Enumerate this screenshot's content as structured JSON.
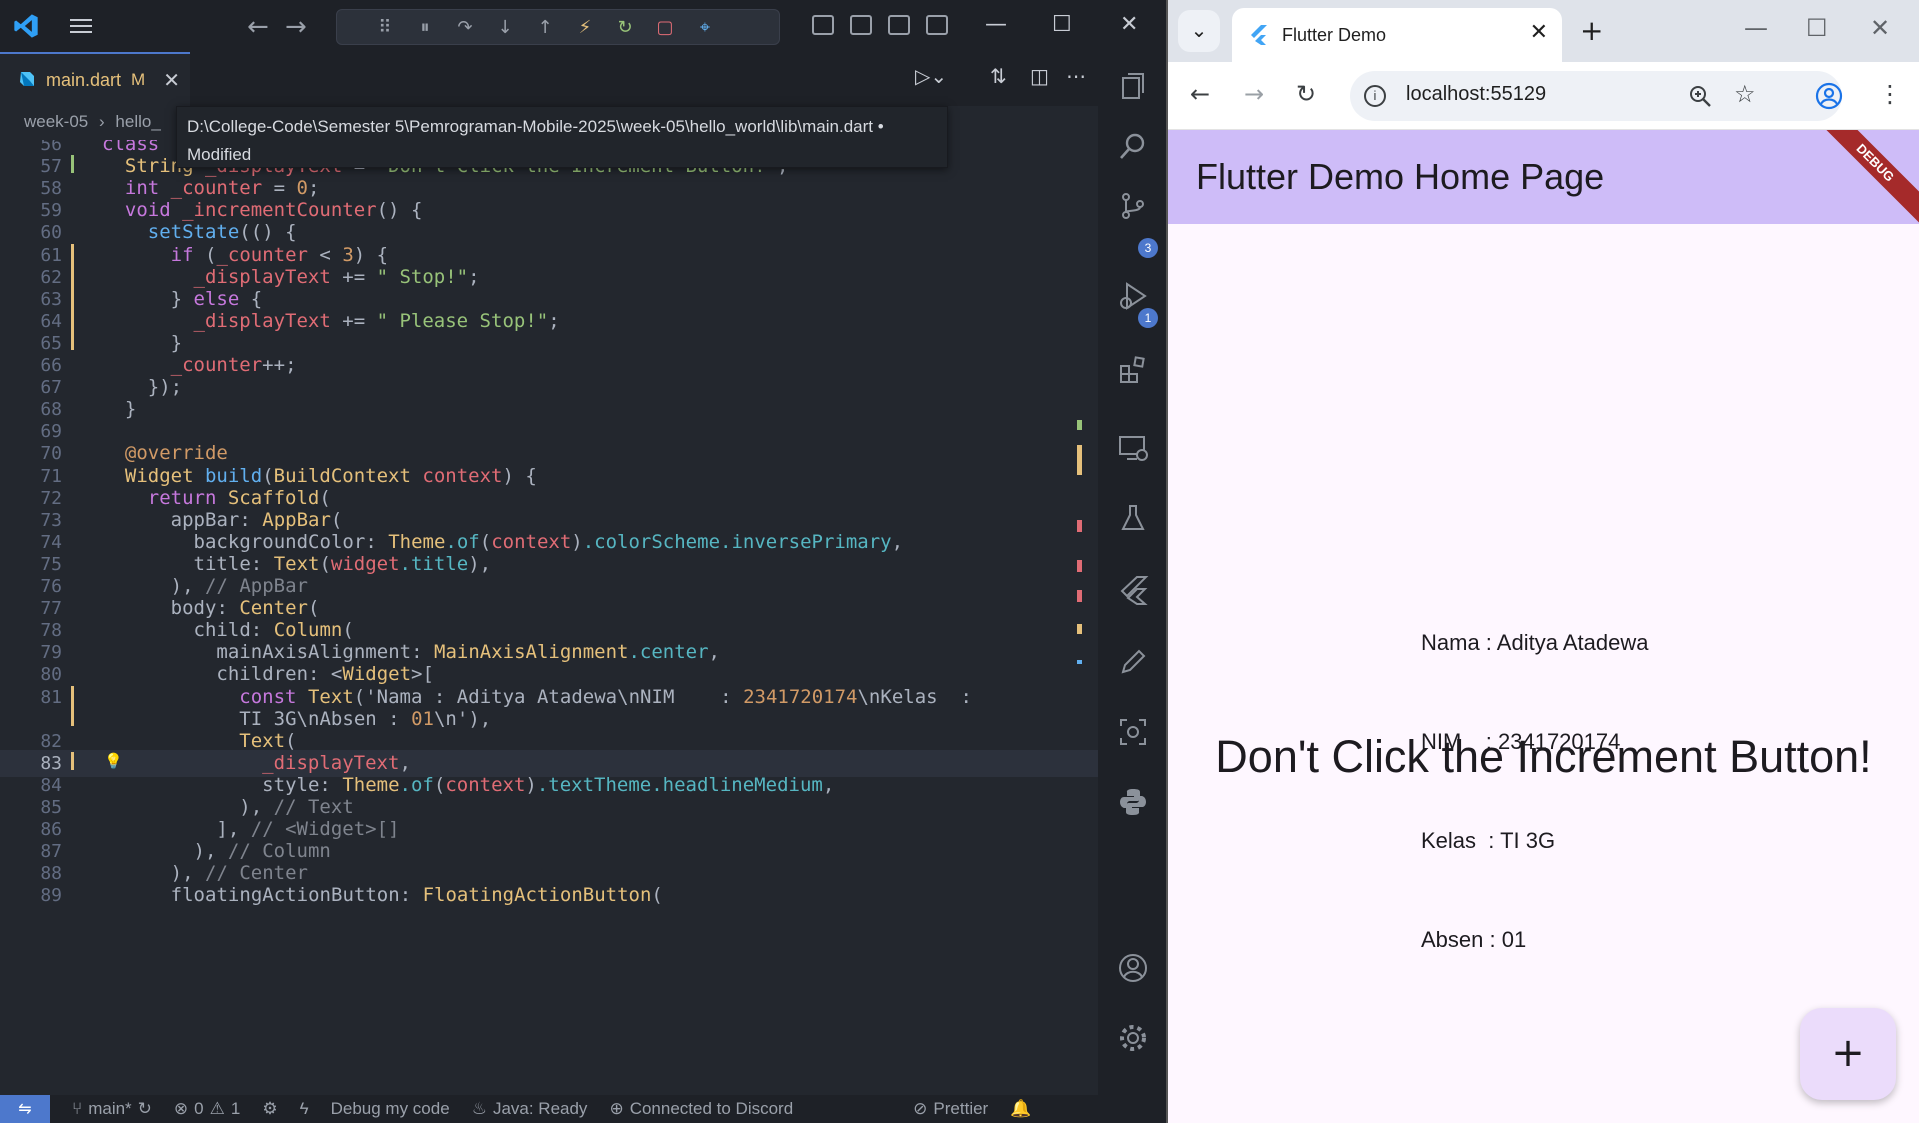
{
  "vscode": {
    "tab": {
      "label": "main.dart",
      "status": "M"
    },
    "breadcrumb": [
      "week-05",
      "hello_"
    ],
    "tooltip": {
      "path": "D:\\College-Code\\Semester 5\\Pemrograman-Mobile-2025\\week-05\\hello_world\\lib\\main.dart •",
      "state": "Modified"
    },
    "activity_badges": {
      "source_control": "3",
      "run_debug": "1"
    },
    "status": {
      "branch": "main*",
      "errors": "0",
      "warnings": "1",
      "debug": "Debug my code",
      "java": "Java: Ready",
      "discord": "Connected to Discord",
      "prettier": "Prettier"
    },
    "code_lines": [
      {
        "n": "56",
        "text": "class"
      },
      {
        "n": "57",
        "text": "  String _displayText = \"Don't Click the Increment Button!\";"
      },
      {
        "n": "58",
        "text": "  int _counter = 0;"
      },
      {
        "n": "59",
        "text": "  void _incrementCounter() {"
      },
      {
        "n": "60",
        "text": "    setState(() {"
      },
      {
        "n": "61",
        "text": "      if (_counter < 3) {"
      },
      {
        "n": "62",
        "text": "        _displayText += \" Stop!\";"
      },
      {
        "n": "63",
        "text": "      } else {"
      },
      {
        "n": "64",
        "text": "        _displayText += \" Please Stop!\";"
      },
      {
        "n": "65",
        "text": "      }"
      },
      {
        "n": "66",
        "text": "      _counter++;"
      },
      {
        "n": "67",
        "text": "    });"
      },
      {
        "n": "68",
        "text": "  }"
      },
      {
        "n": "69",
        "text": ""
      },
      {
        "n": "70",
        "text": "  @override"
      },
      {
        "n": "71",
        "text": "  Widget build(BuildContext context) {"
      },
      {
        "n": "72",
        "text": "    return Scaffold("
      },
      {
        "n": "73",
        "text": "      appBar: AppBar("
      },
      {
        "n": "74",
        "text": "        backgroundColor: Theme.of(context).colorScheme.inversePrimary,"
      },
      {
        "n": "75",
        "text": "        title: Text(widget.title),"
      },
      {
        "n": "76",
        "text": "      ), // AppBar"
      },
      {
        "n": "77",
        "text": "      body: Center("
      },
      {
        "n": "78",
        "text": "        child: Column("
      },
      {
        "n": "79",
        "text": "          mainAxisAlignment: MainAxisAlignment.center,"
      },
      {
        "n": "80",
        "text": "          children: <Widget>["
      },
      {
        "n": "81",
        "text": "            const Text('Nama : Aditya Atadewa\\nNIM    : 2341720174\\nKelas  :"
      },
      {
        "n": "",
        "text": "            TI 3G\\nAbsen : 01\\n'),"
      },
      {
        "n": "82",
        "text": "            Text("
      },
      {
        "n": "83",
        "text": "              _displayText,"
      },
      {
        "n": "84",
        "text": "              style: Theme.of(context).textTheme.headlineMedium,"
      },
      {
        "n": "85",
        "text": "            ), // Text"
      },
      {
        "n": "86",
        "text": "          ], // <Widget>[]"
      },
      {
        "n": "87",
        "text": "        ), // Column"
      },
      {
        "n": "88",
        "text": "      ), // Center"
      },
      {
        "n": "89",
        "text": "      floatingActionButton: FloatingActionButton("
      }
    ]
  },
  "browser": {
    "tab_title": "Flutter Demo",
    "url": "localhost:55129",
    "app": {
      "appbar_title": "Flutter Demo Home Page",
      "debug_banner": "DEBUG",
      "info_lines": [
        "Nama : Aditya Atadewa",
        "NIM    : 2341720174",
        "Kelas  : TI 3G",
        "Absen : 01"
      ],
      "display_text": "Don't Click the Increment Button!",
      "fab_icon": "+"
    }
  },
  "colors": {
    "accent": "#4d78cc",
    "appbar": "#cebcf8",
    "fab": "#ebdcfb",
    "debug_banner": "#a52a2a"
  }
}
